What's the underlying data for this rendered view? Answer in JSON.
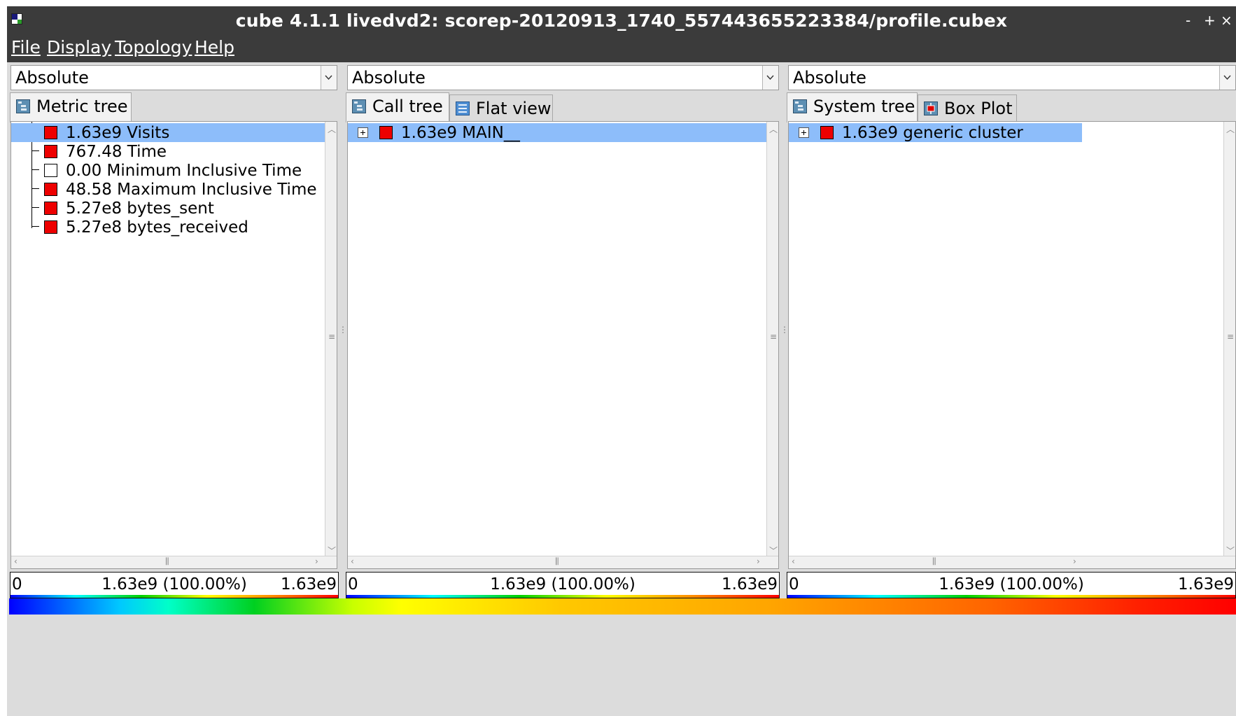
{
  "window": {
    "title": "cube 4.1.1 livedvd2: scorep-20120913_1740_557443655223384/profile.cubex"
  },
  "window_controls": {
    "minimize": "-",
    "maximize": "+",
    "close": "×"
  },
  "menu": [
    {
      "label": "File"
    },
    {
      "label": "Display"
    },
    {
      "label": "Topology"
    },
    {
      "label": "Help"
    }
  ],
  "colors": {
    "metric_red": "#ee0000",
    "selection": "#8dbdfa",
    "title_bg": "#3b3b3b"
  },
  "metric_panel": {
    "mode": "Absolute",
    "tabs": [
      {
        "label": "Metric tree",
        "icon": "tree-icon"
      }
    ],
    "rows": [
      {
        "label": "1.63e9 Visits",
        "color": "#ee0000",
        "selected": true
      },
      {
        "label": "767.48 Time",
        "color": "#ee0000"
      },
      {
        "label": "0.00 Minimum Inclusive Time",
        "color": "#ffffff"
      },
      {
        "label": "48.58 Maximum Inclusive Time",
        "color": "#ee0000"
      },
      {
        "label": "5.27e8 bytes_sent",
        "color": "#ee0000"
      },
      {
        "label": "5.27e8 bytes_received",
        "color": "#ee0000"
      }
    ],
    "scale": {
      "min": "0",
      "mid": "1.63e9 (100.00%)",
      "max": "1.63e9"
    }
  },
  "call_panel": {
    "mode": "Absolute",
    "tabs": [
      {
        "label": "Call tree",
        "icon": "tree-icon"
      },
      {
        "label": "Flat view",
        "icon": "list-icon"
      }
    ],
    "rows": [
      {
        "label": "1.63e9 MAIN__",
        "color": "#ee0000",
        "selected": true
      }
    ],
    "scale": {
      "min": "0",
      "mid": "1.63e9 (100.00%)",
      "max": "1.63e9"
    }
  },
  "system_panel": {
    "mode": "Absolute",
    "tabs": [
      {
        "label": "System tree",
        "icon": "tree-icon"
      },
      {
        "label": "Box Plot",
        "icon": "box-plot-icon"
      }
    ],
    "rows": [
      {
        "label": "1.63e9 generic cluster",
        "color": "#ee0000",
        "selected": true
      }
    ],
    "scale": {
      "min": "0",
      "mid": "1.63e9 (100.00%)",
      "max": "1.63e9"
    }
  }
}
